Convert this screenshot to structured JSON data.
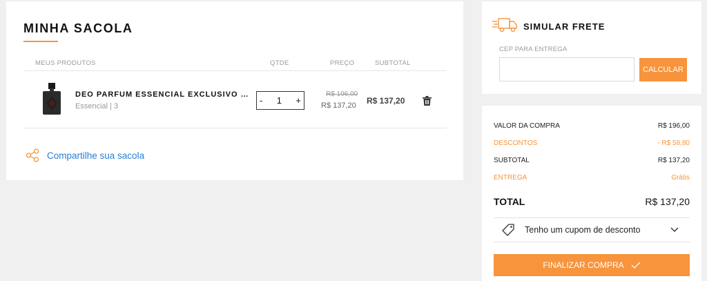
{
  "cart": {
    "title": "MINHA SACOLA",
    "columns": {
      "products": "MEUS PRODUTOS",
      "qty": "QTDE",
      "price": "PREÇO",
      "subtotal": "SUBTOTAL"
    },
    "item": {
      "name": "DEO PARFUM ESSENCIAL EXCLUSIVO …",
      "variant": "Essencial | 3",
      "quantity": "1",
      "qty_minus": "-",
      "qty_plus": "+",
      "price_old": "R$ 196,00",
      "price_new": "R$ 137,20",
      "subtotal": "R$ 137,20"
    },
    "share_label": "Compartilhe sua sacola"
  },
  "frete": {
    "title": "SIMULAR FRETE",
    "cep_label": "CEP PARA ENTREGA",
    "cep_value": "",
    "calc_label": "CALCULAR"
  },
  "summary": {
    "rows": [
      {
        "label": "VALOR DA COMPRA",
        "value": "R$ 196,00"
      },
      {
        "label": "DESCONTOS",
        "value": "- R$ 58,80"
      },
      {
        "label": "SUBTOTAL",
        "value": "R$ 137,20"
      },
      {
        "label": "ENTREGA",
        "value": "Grátis"
      }
    ],
    "total_label": "TOTAL",
    "total_value": "R$ 137,20",
    "coupon_label": "Tenho um cupom de desconto",
    "finish_label": "FINALIZAR COMPRA"
  },
  "colors": {
    "accent": "#f7943c",
    "link": "#2a7fd3",
    "background": "#f0f0f0"
  },
  "icons": [
    "perfume-bottle-image",
    "trash-icon",
    "share-icon",
    "truck-icon",
    "tag-icon",
    "chevron-down-icon",
    "check-icon"
  ]
}
